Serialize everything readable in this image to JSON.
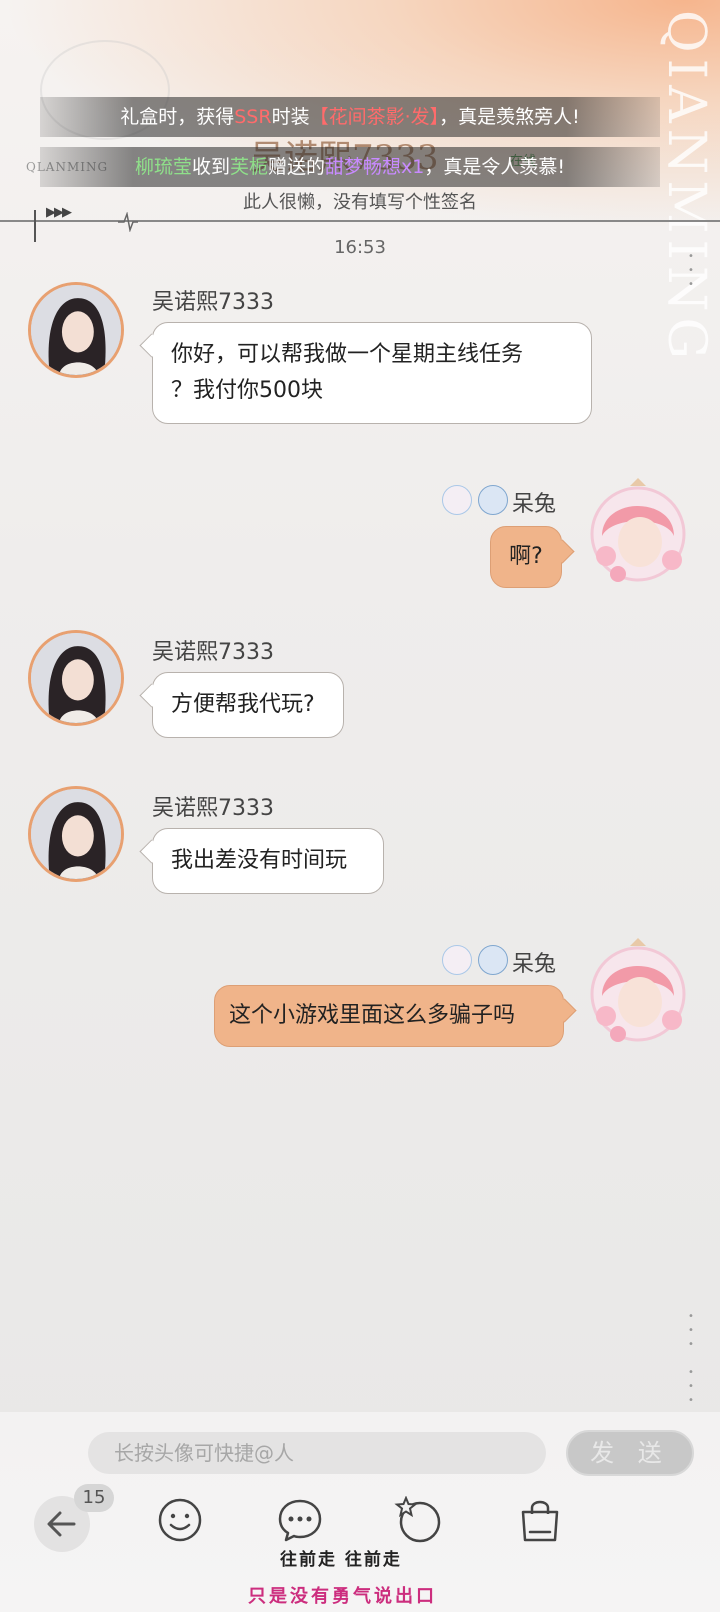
{
  "header": {
    "marquee_1": {
      "prefix": "礼盒时，获得",
      "rarity": "SSR",
      "mid": "时装",
      "item": "【花间茶影·发】",
      "suffix": "，真是羡煞旁人!"
    },
    "marquee_2": {
      "player": "柳琉莹",
      "action": "收到",
      "giver": "芙栀",
      "verb": "赠送的",
      "gift": "甜梦畅想x1",
      "suffix": "，真是令人羡慕!"
    },
    "profile_name": "吴诺熙7333",
    "logo_text": "QLANMING",
    "status": "在线",
    "signature": "此人很懒，没有填写个性签名",
    "audio_arrows": "▶▶▶"
  },
  "chat": {
    "timestamp": "16:53",
    "messages": [
      {
        "side": "left",
        "sender": "吴诺熙7333",
        "text_line1": "你好，可以帮我做一个星期主线任务",
        "text_line2": "？我付你500块"
      },
      {
        "side": "right",
        "sender": "呆兔",
        "text": "啊?"
      },
      {
        "side": "left",
        "sender": "吴诺熙7333",
        "text": "方便帮我代玩?"
      },
      {
        "side": "left",
        "sender": "吴诺熙7333",
        "text": "我出差没有时间玩"
      },
      {
        "side": "right",
        "sender": "呆兔",
        "text": "这个小游戏里面这么多骗子吗"
      }
    ]
  },
  "input": {
    "placeholder": "长按头像可快捷@人",
    "send_label": "发 送"
  },
  "toolbar": {
    "back_count": "15",
    "icons": [
      "back-arrow-icon",
      "emoji-icon",
      "chat-bubble-icon",
      "star-circle-icon",
      "shopping-bag-icon"
    ]
  },
  "overlay": {
    "caption_1": "往前走 往前走",
    "caption_2": "只是没有勇气说出口"
  },
  "colors": {
    "accent_orange": "#f0b48a",
    "avatar_border": "#e8a070",
    "caption_pink": "#cc2d7e"
  }
}
